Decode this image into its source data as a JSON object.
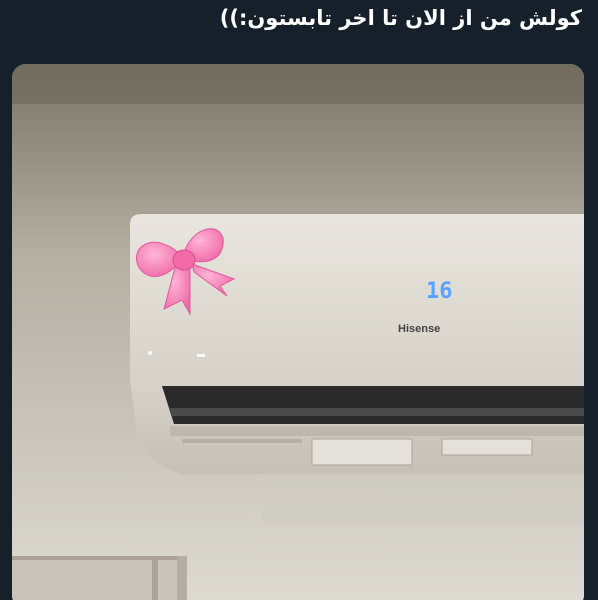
{
  "tweet": {
    "text_main": "کولش من از الان تا اخر تابستون:))",
    "sparkle_icon": "sparkles-emoji",
    "text_color": "#ffffff",
    "background_color": "#15202b"
  },
  "media": {
    "ac_display_value": "16",
    "ac_brand": "Hisense",
    "decoration": "pink-bow-emoji"
  }
}
